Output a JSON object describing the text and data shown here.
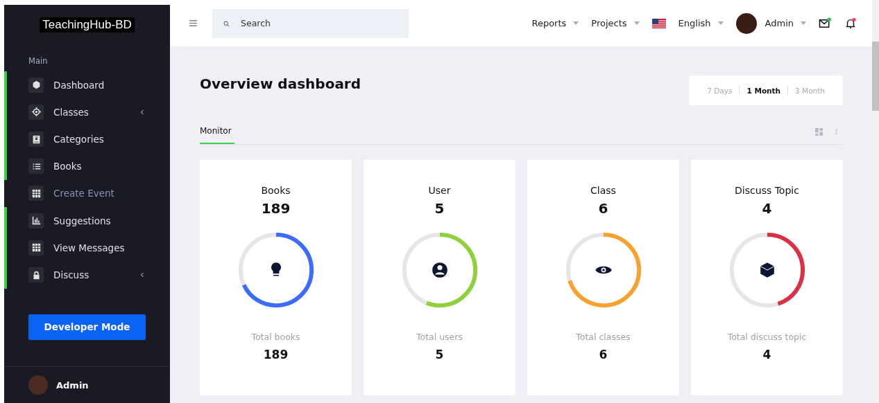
{
  "sidebar": {
    "logo": "TeachingHub-BD",
    "section": "Main",
    "items": [
      {
        "label": "Dashboard",
        "active": true,
        "submenu": false
      },
      {
        "label": "Classes",
        "active": true,
        "submenu": true
      },
      {
        "label": "Categories",
        "active": true,
        "submenu": false
      },
      {
        "label": "Books",
        "active": true,
        "submenu": false
      },
      {
        "label": "Create Event",
        "active": false,
        "submenu": false
      },
      {
        "label": "Suggestions",
        "active": true,
        "submenu": false
      },
      {
        "label": "View Messages",
        "active": true,
        "submenu": false
      },
      {
        "label": "Discuss",
        "active": true,
        "submenu": true
      }
    ],
    "button": "Developer Mode",
    "user": "Admin"
  },
  "topbar": {
    "search": {
      "placeholder": "Search"
    },
    "menus": [
      "Reports",
      "Projects"
    ],
    "language": "English",
    "user": "Admin"
  },
  "page": {
    "title": "Overview dashboard",
    "ranges": [
      {
        "label": "7 Days",
        "selected": false
      },
      {
        "label": "1 Month",
        "selected": true
      },
      {
        "label": "3 Month",
        "selected": false
      }
    ],
    "tabs": [
      {
        "label": "Monitor",
        "selected": true
      }
    ],
    "cards": [
      {
        "title": "Books",
        "value": "189",
        "level": 0.68,
        "color": "#3b6bff",
        "caption": "Total books",
        "total": "189"
      },
      {
        "title": "User",
        "value": "5",
        "level": 0.56,
        "color": "#8fd13a",
        "caption": "Total users",
        "total": "5"
      },
      {
        "title": "Class",
        "value": "6",
        "level": 0.7,
        "color": "#f7a22e",
        "caption": "Total classes",
        "total": "6"
      },
      {
        "title": "Discuss Topic",
        "value": "4",
        "level": 0.45,
        "color": "#dd2f45",
        "caption": "Total discuss topic",
        "total": "4"
      }
    ]
  }
}
